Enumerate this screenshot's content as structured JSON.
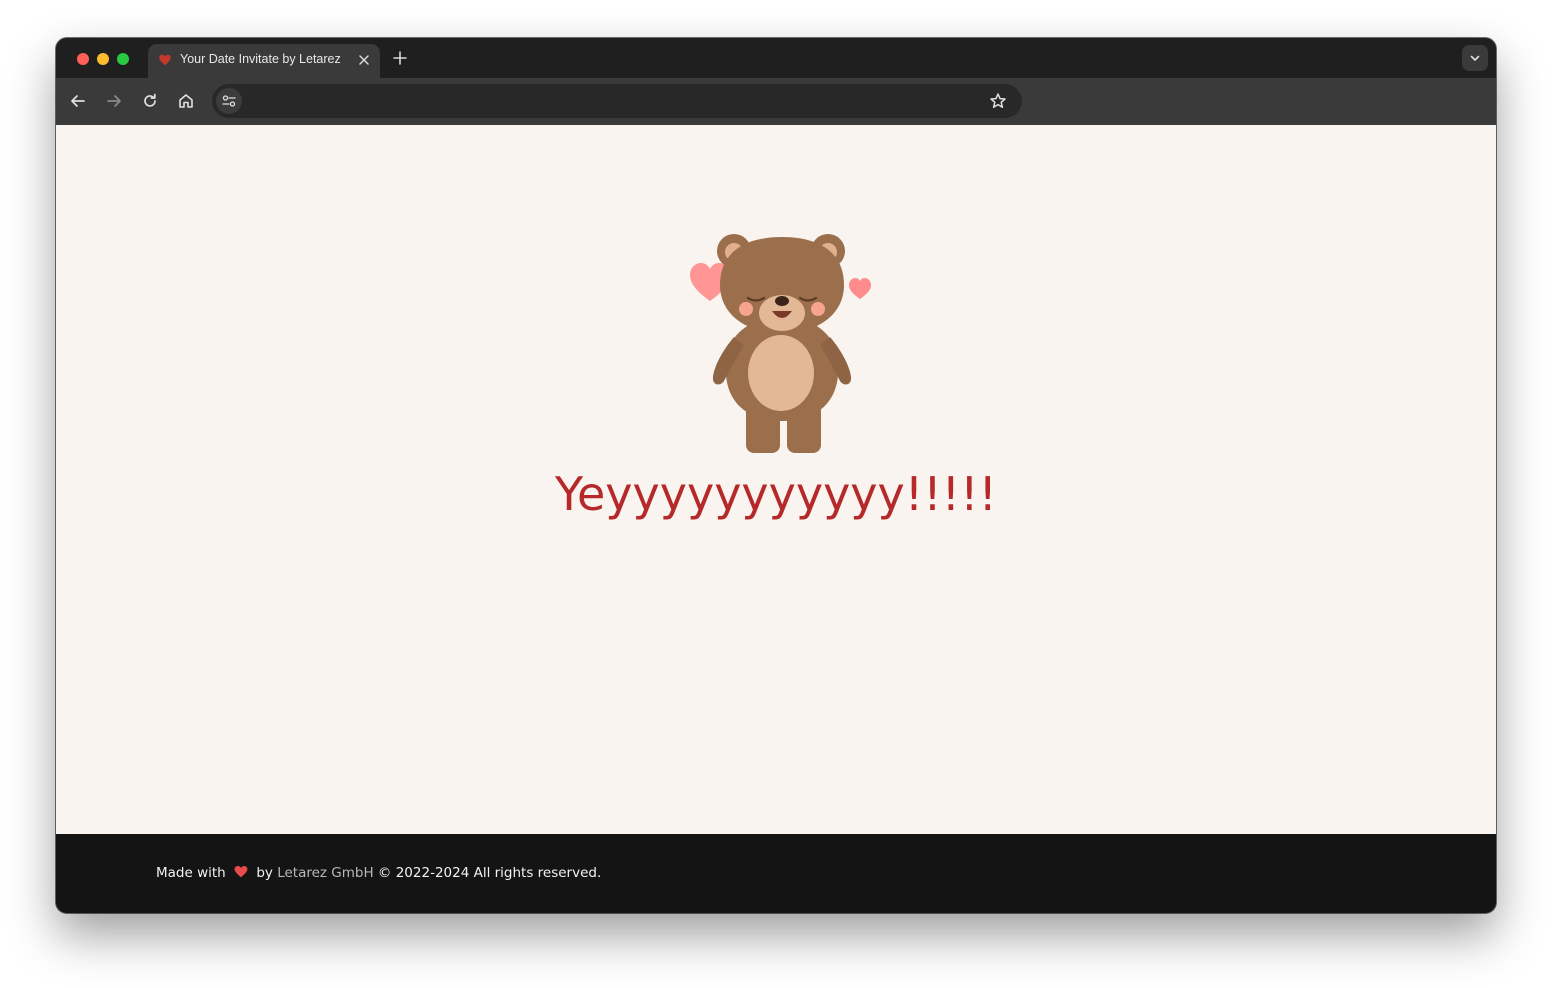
{
  "browser": {
    "tab_title": "Your Date Invitate by Letarez",
    "address_text": "",
    "favicon": "heart-icon",
    "colors": {
      "tabstrip": "#1f1f1f",
      "toolbar": "#3a3a3a",
      "omnibox": "#282828",
      "close_dot": "#ff5f57",
      "minimize_dot": "#febc2e",
      "maximize_dot": "#28c840"
    }
  },
  "page": {
    "illustration": "teddy-bear-with-hearts",
    "headline": "Yeyyyyyyyyyyy!!!!!",
    "colors": {
      "background": "#f9f4ef",
      "headline": "#b5292b"
    }
  },
  "footer": {
    "made_with": "Made with",
    "by": "by",
    "company": "Letarez GmbH",
    "copyright": "© 2022-2024 All rights reserved.",
    "colors": {
      "background": "#141414",
      "heart": "#e74c4c"
    }
  }
}
